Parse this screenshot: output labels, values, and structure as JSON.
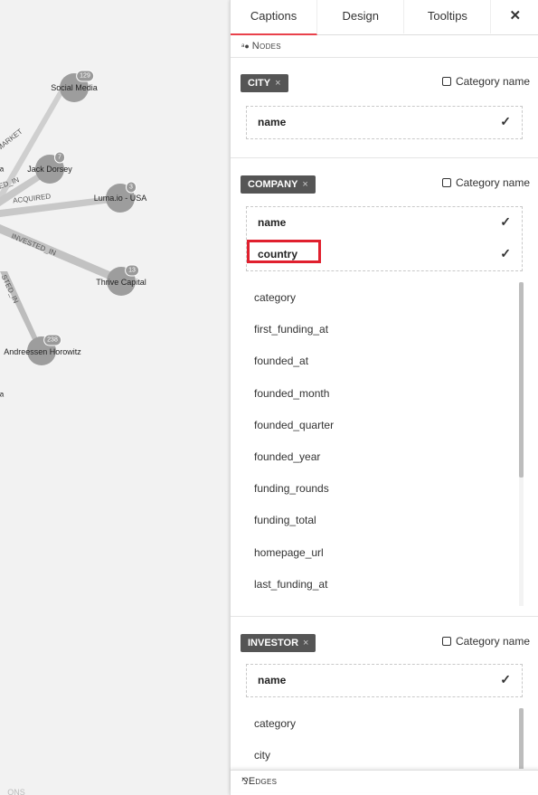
{
  "graph": {
    "nodes": [
      {
        "label": "Social Media",
        "badge": "129"
      },
      {
        "label": "Jack Dorsey",
        "badge": "7"
      },
      {
        "label": "Luma.io - USA",
        "badge": "3"
      },
      {
        "label": "Thrive Capital",
        "badge": "13"
      },
      {
        "label": "Andreessen Horowitz",
        "badge": "238"
      }
    ],
    "edge_labels": [
      "MARKET",
      "ED_IN",
      "ACQUIRED",
      "INVESTED_IN",
      "STED_IN"
    ],
    "stray_labels": [
      "a",
      "a",
      "ONS"
    ]
  },
  "panel": {
    "tabs": [
      "Captions",
      "Design",
      "Tooltips"
    ],
    "close": "✕",
    "nodes_header": "Nodes",
    "edges_header": "Edges",
    "category_name_label": "Category name",
    "categories": {
      "city": {
        "badge": "CITY",
        "selected": [
          "name"
        ]
      },
      "company": {
        "badge": "COMPANY",
        "selected": [
          "name",
          "country"
        ],
        "options": [
          "category",
          "first_funding_at",
          "founded_at",
          "founded_month",
          "founded_quarter",
          "founded_year",
          "funding_rounds",
          "funding_total",
          "homepage_url",
          "last_funding_at"
        ]
      },
      "investor": {
        "badge": "INVESTOR",
        "selected": [
          "name"
        ],
        "options": [
          "category",
          "city"
        ]
      }
    },
    "check_glyph": "✓",
    "remove_glyph": "×",
    "colors": {
      "active_tab": "#e9414b",
      "highlight": "#e0202e",
      "badge_bg": "#555555"
    }
  }
}
